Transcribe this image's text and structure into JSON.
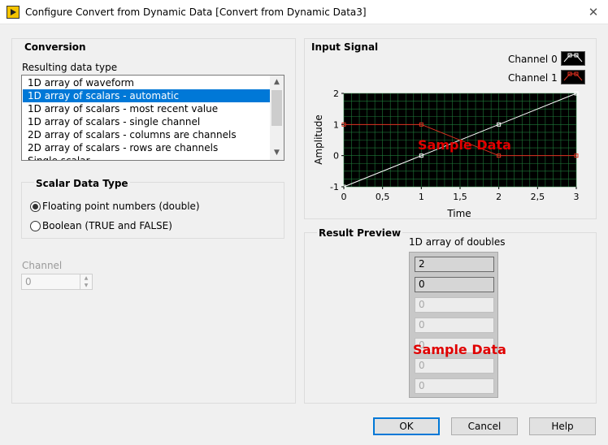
{
  "window": {
    "title": "Configure Convert from Dynamic Data [Convert from Dynamic Data3]",
    "close_glyph": "✕"
  },
  "conversion": {
    "group_title": "Conversion",
    "result_type_label": "Resulting data type",
    "items": [
      "1D array of waveform",
      "1D array of scalars - automatic",
      "1D array of scalars - most recent value",
      "1D array of scalars - single channel",
      "2D array of scalars - columns are channels",
      "2D array of scalars - rows are channels",
      "Single scalar"
    ],
    "selected_index": 1,
    "scroll_up_glyph": "▲",
    "scroll_down_glyph": "▼"
  },
  "scalar_type": {
    "group_title": "Scalar Data Type",
    "options": [
      "Floating point numbers (double)",
      "Boolean (TRUE and FALSE)"
    ],
    "selected_index": 0
  },
  "channel": {
    "label": "Channel",
    "value": "0",
    "up_glyph": "▲",
    "down_glyph": "▼"
  },
  "input_signal": {
    "group_title": "Input Signal",
    "legend": [
      {
        "name": "Channel 0",
        "color": "#ffffff"
      },
      {
        "name": "Channel 1",
        "color": "#e03020"
      }
    ],
    "watermark": "Sample Data"
  },
  "chart_data": {
    "type": "line",
    "xlabel": "Time",
    "ylabel": "Amplitude",
    "xlim": [
      0,
      3
    ],
    "ylim": [
      -1,
      2
    ],
    "xticks": [
      "0",
      "0,5",
      "1",
      "1,5",
      "2",
      "2,5",
      "3"
    ],
    "yticks": [
      "-1",
      "0",
      "1",
      "2"
    ],
    "grid": true,
    "background": "#000000",
    "grid_color": "#1f7a3a",
    "series": [
      {
        "name": "Channel 0",
        "color": "#ffffff",
        "x": [
          0,
          1,
          2,
          3
        ],
        "y": [
          -1,
          0,
          1,
          2
        ]
      },
      {
        "name": "Channel 1",
        "color": "#e03020",
        "x": [
          0,
          1,
          2,
          3
        ],
        "y": [
          1,
          1,
          0,
          0
        ]
      }
    ]
  },
  "result_preview": {
    "group_title": "Result Preview",
    "array_label": "1D array of doubles",
    "values": [
      "2",
      "0",
      "0",
      "0",
      "0",
      "0",
      "0"
    ],
    "active_count": 2,
    "watermark": "Sample Data"
  },
  "buttons": {
    "ok": "OK",
    "cancel": "Cancel",
    "help": "Help"
  }
}
